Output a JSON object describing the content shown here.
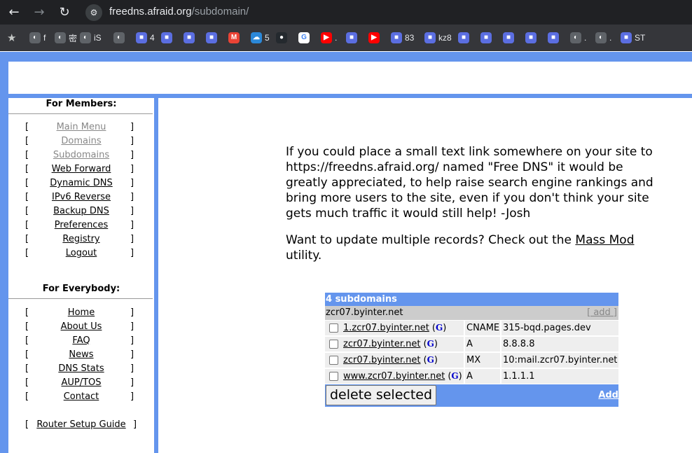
{
  "browser": {
    "url_host": "freedns.afraid.org",
    "url_path": "/subdomain/",
    "bookmarks": [
      {
        "icon": "globe-icon",
        "label": "f"
      },
      {
        "icon": "globe-icon",
        "label": "密"
      },
      {
        "icon": "globe-icon",
        "label": "iS"
      },
      {
        "icon": "globe-icon",
        "label": ""
      },
      {
        "icon": "app-icon",
        "label": "4"
      },
      {
        "icon": "app-icon",
        "label": ""
      },
      {
        "icon": "app-icon",
        "label": ""
      },
      {
        "icon": "app-icon",
        "label": ""
      },
      {
        "icon": "gmail-icon",
        "label": ""
      },
      {
        "icon": "cloud-icon",
        "label": "5"
      },
      {
        "icon": "github-icon",
        "label": ""
      },
      {
        "icon": "google-icon",
        "label": ""
      },
      {
        "icon": "youtube-icon",
        "label": "."
      },
      {
        "icon": "app-icon",
        "label": ""
      },
      {
        "icon": "youtube-icon",
        "label": ""
      },
      {
        "icon": "app-icon",
        "label": "83"
      },
      {
        "icon": "app-icon",
        "label": "kz8"
      },
      {
        "icon": "app-icon",
        "label": ""
      },
      {
        "icon": "app-icon",
        "label": ""
      },
      {
        "icon": "app-icon",
        "label": ""
      },
      {
        "icon": "app-icon",
        "label": ""
      },
      {
        "icon": "app-icon",
        "label": ""
      },
      {
        "icon": "globe-icon",
        "label": "."
      },
      {
        "icon": "globe-icon",
        "label": "."
      },
      {
        "icon": "app-icon",
        "label": "ST"
      }
    ]
  },
  "sidebar": {
    "members_heading": "For Members:",
    "members_items": [
      "Main Menu",
      "Domains",
      "Subdomains",
      "Web Forward",
      "Dynamic DNS",
      "IPv6 Reverse",
      "Backup DNS",
      "Preferences",
      "Registry",
      "Logout"
    ],
    "everybody_heading": "For Everybody:",
    "everybody_items": [
      "Home",
      "About Us",
      "FAQ",
      "News",
      "DNS Stats",
      "AUP/TOS",
      "Contact"
    ],
    "router_guide": "Router Setup Guide",
    "bracket_left": "[",
    "bracket_right": "]"
  },
  "main": {
    "intro_text": "If you could place a small text link somewhere on your site to https://freedns.afraid.org/ named \"Free DNS\" it would be greatly appreciated, to help raise search engine rankings and bring more users to the site, even if you don't think your site gets much traffic it would still help! -Josh",
    "mass_prefix": "Want to update multiple records? Check out the ",
    "mass_link": "Mass Mod",
    "mass_suffix": "utility."
  },
  "table": {
    "header": "4 subdomains",
    "domain": "zcr07.byinter.net",
    "add_label": "[ add ]",
    "g_label": "G",
    "records": [
      {
        "name": "1.zcr07.byinter.net",
        "type": "CNAME",
        "value": "315-bqd.pages.dev"
      },
      {
        "name": "zcr07.byinter.net",
        "type": "A",
        "value": "8.8.8.8"
      },
      {
        "name": "zcr07.byinter.net",
        "type": "MX",
        "value": "10:mail.zcr07.byinter.net"
      },
      {
        "name": "www.zcr07.byinter.net",
        "type": "A",
        "value": "1.1.1.1"
      }
    ],
    "delete_label": "delete selected",
    "footer_add": "Add"
  }
}
